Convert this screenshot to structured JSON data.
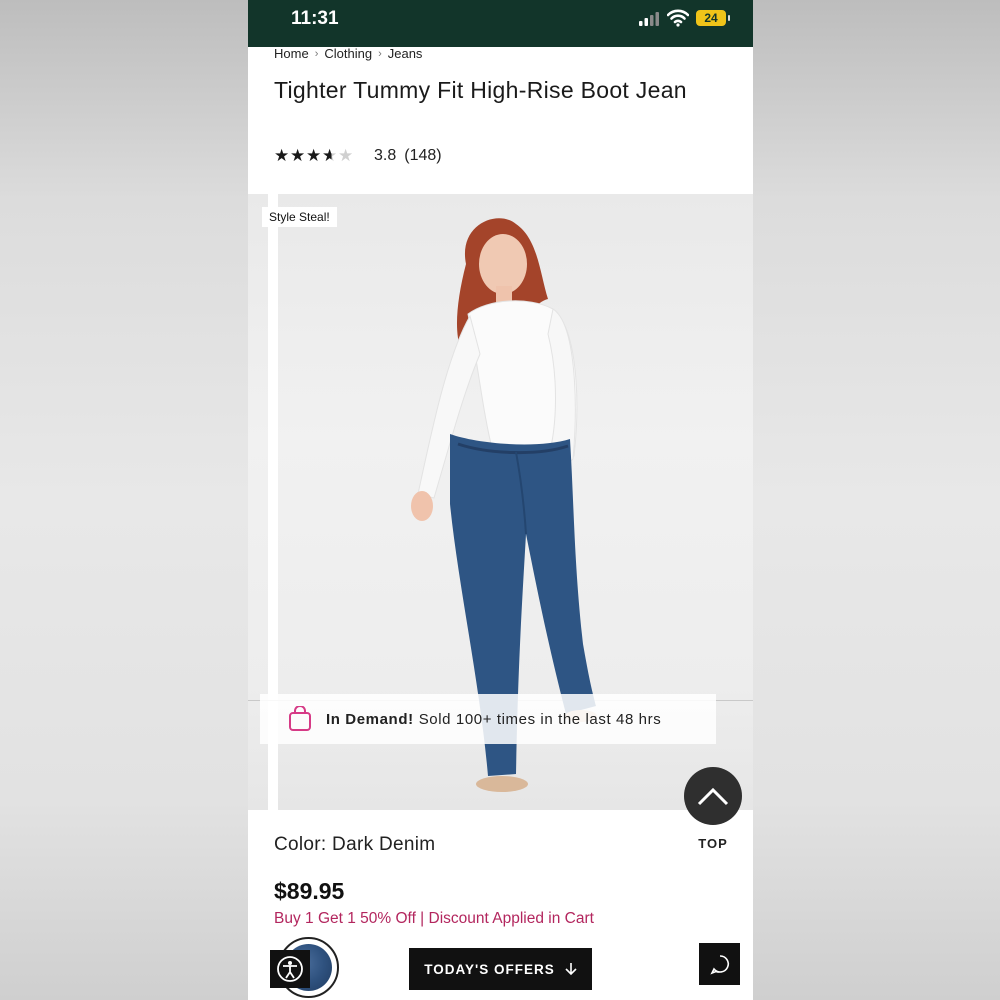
{
  "status_bar": {
    "time": "11:31",
    "battery": "24"
  },
  "breadcrumb": [
    "Home",
    "Clothing",
    "Jeans"
  ],
  "product": {
    "title": "Tighter Tummy Fit High-Rise Boot Jean",
    "rating": 3.8,
    "rating_text": "3.8",
    "review_count": "(148)",
    "badge": "Style Steal!",
    "demand_strong": "In Demand!",
    "demand_text": "Sold 100+ times in the last 48 hrs",
    "color_label": "Color: Dark Denim",
    "price": "$89.95",
    "promo": "Buy 1 Get 1 50% Off | Discount Applied in Cart"
  },
  "controls": {
    "top_label": "TOP",
    "offers_label": "TODAY'S OFFERS"
  },
  "colors": {
    "status_bar": "#12352a",
    "promo": "#b3265e",
    "bag_icon": "#d63a86"
  }
}
